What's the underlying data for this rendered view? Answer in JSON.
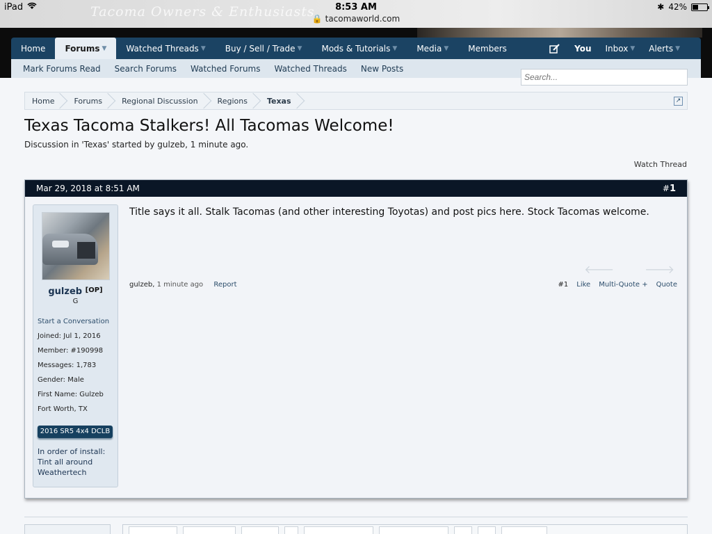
{
  "status_bar": {
    "device": "iPad",
    "time": "8:53 AM",
    "url": "tacomaworld.com",
    "battery": "42%",
    "battery_level": 0.42,
    "background_title": "Tacoma Owners & Enthusiasts"
  },
  "main_nav": {
    "tabs": [
      {
        "label": "Home",
        "has_menu": false,
        "active": false
      },
      {
        "label": "Forums",
        "has_menu": true,
        "active": true
      },
      {
        "label": "Watched Threads",
        "has_menu": true,
        "active": false
      },
      {
        "label": "Buy / Sell / Trade",
        "has_menu": true,
        "active": false
      },
      {
        "label": "Mods & Tutorials",
        "has_menu": true,
        "active": false
      },
      {
        "label": "Media",
        "has_menu": true,
        "active": false
      },
      {
        "label": "Members",
        "has_menu": false,
        "active": false
      }
    ],
    "right": {
      "you": "You",
      "inbox": "Inbox",
      "alerts": "Alerts"
    }
  },
  "sub_nav": [
    "Mark Forums Read",
    "Search Forums",
    "Watched Forums",
    "Watched Threads",
    "New Posts"
  ],
  "search": {
    "placeholder": "Search..."
  },
  "breadcrumb": [
    "Home",
    "Forums",
    "Regional Discussion",
    "Regions",
    "Texas"
  ],
  "thread": {
    "title": "Texas Tacoma Stalkers! All Tacomas Welcome!",
    "description": "Discussion in 'Texas' started by gulzeb, 1 minute ago.",
    "watch_label": "Watch Thread"
  },
  "post": {
    "date": "Mar 29, 2018 at 8:51 AM",
    "number_prefix": "#",
    "number": "1",
    "message": "Title says it all. Stalk Tacomas (and other interesting Toyotas) and post pics here. Stock Tacomas welcome.",
    "author": "gulzeb",
    "time": "1 minute ago",
    "report": "Report",
    "post_ref": "#1",
    "like": "Like",
    "multiquote": "Multi-Quote +",
    "quote": "Quote"
  },
  "user": {
    "name": "gulzeb",
    "op_tag": "[OP]",
    "title": "G",
    "start_conversation": "Start a Conversation",
    "stats": [
      "Joined: Jul 1, 2016",
      "Member: #190998",
      "Messages: 1,783",
      "Gender: Male",
      "First Name: Gulzeb",
      "Fort Worth, TX"
    ],
    "truck_badge": "2016 SR5 4x4 DCLB",
    "signature": [
      "In order of install:",
      "Tint all around",
      "Weathertech"
    ]
  },
  "colors": {
    "nav_bg": "#1b4363",
    "post_header_bg": "#0a1626",
    "link": "#2b4c6a"
  }
}
